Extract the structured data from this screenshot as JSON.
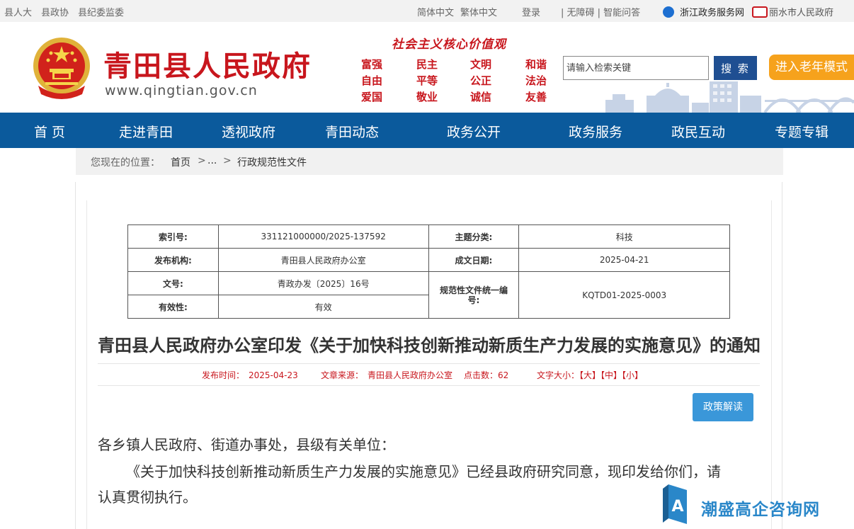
{
  "topbar": {
    "links_left": [
      "县人大",
      "县政协",
      "县纪委监委"
    ],
    "lang_simplified": "简体中文",
    "lang_traditional": "繁体中文",
    "login": "登录",
    "accessibility": "| 无障碍 | 智能问答",
    "zj_portal": "浙江政务服务网",
    "lishui": "丽水市人民政府"
  },
  "header": {
    "title": "青田县人民政府",
    "url": "www.qingtian.gov.cn",
    "values_title": "社会主义核心价值观",
    "values": [
      "富强",
      "民主",
      "文明",
      "和谐",
      "自由",
      "平等",
      "公正",
      "法治",
      "爱国",
      "敬业",
      "诚信",
      "友善"
    ],
    "search_placeholder": "请输入检索关键",
    "search_button": "搜 索",
    "elder_mode": "进入老年模式"
  },
  "nav": [
    "首 页",
    "走进青田",
    "透视政府",
    "青田动态",
    "政务公开",
    "政务服务",
    "政民互动",
    "专题专辑"
  ],
  "breadcrumb": {
    "prefix": "您现在的位置：",
    "home": "首页",
    "sep": ">",
    "ellipsis": "...",
    "current": "行政规范性文件"
  },
  "meta": {
    "index_label": "索引号:",
    "index_value": "331121000000/2025-137592",
    "topic_label": "主题分类:",
    "topic_value": "科技",
    "org_label": "发布机构:",
    "org_value": "青田县人民政府办公室",
    "date_label": "成文日期:",
    "date_value": "2025-04-21",
    "docno_label": "文号:",
    "docno_value": "青政办发〔2025〕16号",
    "code_label": "规范性文件统一编号:",
    "code_value": "KQTD01-2025-0003",
    "valid_label": "有效性:",
    "valid_value": "有效"
  },
  "article": {
    "title": "青田县人民政府办公室印发《关于加快科技创新推动新质生产力发展的实施意见》的通知",
    "publish_label": "发布时间：",
    "publish_date": "2025-04-23",
    "source_label": "文章来源：",
    "source": "青田县人民政府办公室",
    "clicks_label": "点击数：",
    "clicks": "62",
    "fontsize_label": "文字大小：",
    "font_large": "【大】",
    "font_medium": "【中】",
    "font_small": "【小】",
    "interpret_button": "政策解读",
    "salutation": "各乡镇人民政府、街道办事处，县级有关单位：",
    "body_line1": "《关于加快科技创新推动新质生产力发展的实施意见》已经县政府研究同意，现印发给你们，请",
    "body_line2": "认真贯彻执行。"
  },
  "watermark": {
    "text": "潮盛高企咨询网"
  },
  "colors": {
    "brand_red": "#c8161d",
    "nav_blue": "#0b5a9c",
    "search_blue": "#1f4f92",
    "elder_orange": "#f6a21c",
    "button_blue": "#3a97d9"
  }
}
